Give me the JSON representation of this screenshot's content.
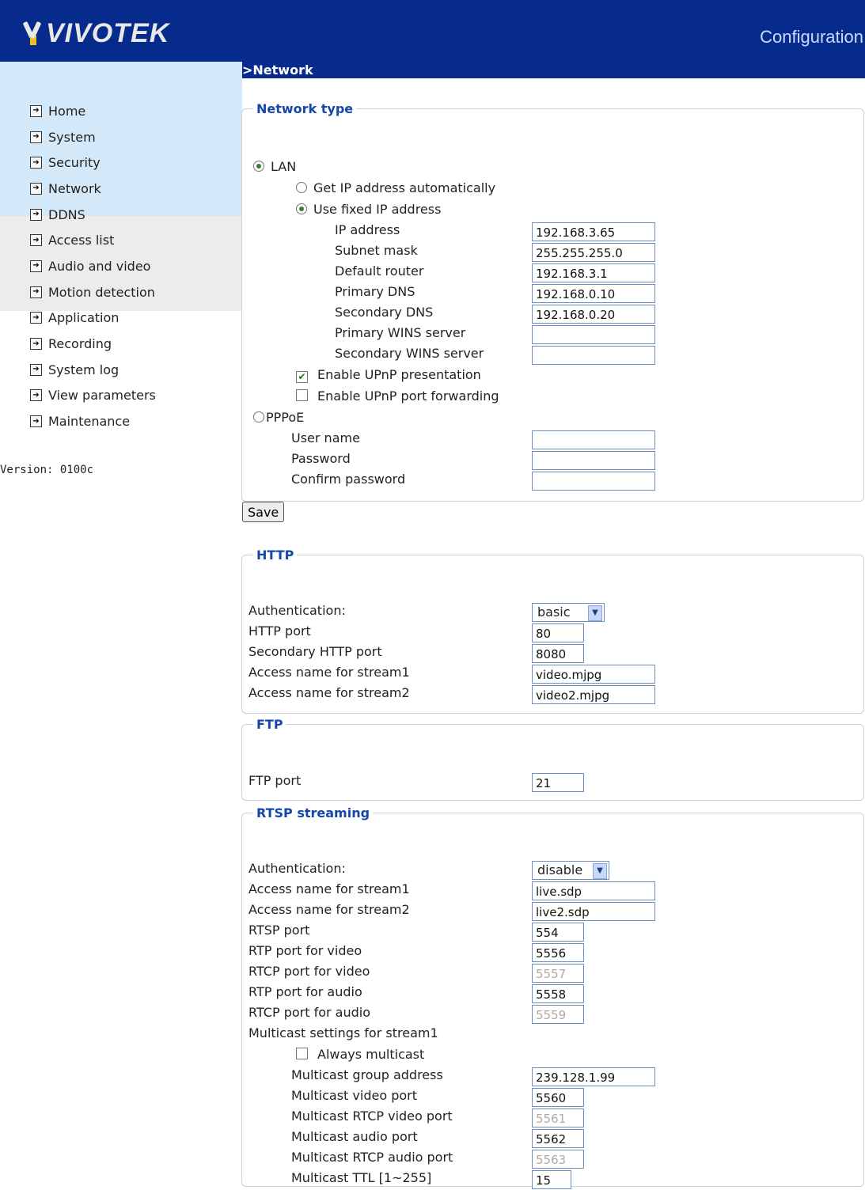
{
  "header": {
    "brand": "VIVOTEK",
    "title": "Configuration"
  },
  "sidebar": {
    "items": [
      {
        "label": "Home"
      },
      {
        "label": "System"
      },
      {
        "label": "Security"
      },
      {
        "label": "Network"
      },
      {
        "label": "DDNS"
      },
      {
        "label": "Access list"
      },
      {
        "label": "Audio and video"
      },
      {
        "label": "Motion detection"
      },
      {
        "label": "Application"
      },
      {
        "label": "Recording"
      },
      {
        "label": "System log"
      },
      {
        "label": "View parameters"
      },
      {
        "label": "Maintenance"
      }
    ],
    "version": "Version: 0100c"
  },
  "section_title": ">Network",
  "network_type": {
    "legend": "Network type",
    "lan_label": "LAN",
    "auto_label": "Get IP address automatically",
    "fixed_label": "Use fixed IP address",
    "fields": {
      "ip_label": "IP address",
      "ip_value": "192.168.3.65",
      "mask_label": "Subnet mask",
      "mask_value": "255.255.255.0",
      "router_label": "Default router",
      "router_value": "192.168.3.1",
      "dns1_label": "Primary DNS",
      "dns1_value": "192.168.0.10",
      "dns2_label": "Secondary DNS",
      "dns2_value": "192.168.0.20",
      "wins1_label": "Primary WINS server",
      "wins1_value": "",
      "wins2_label": "Secondary WINS server",
      "wins2_value": ""
    },
    "upnp_presentation": "Enable UPnP presentation",
    "upnp_forwarding": "Enable UPnP port forwarding",
    "pppoe_label": "PPPoE",
    "pppoe": {
      "user_label": "User name",
      "pass_label": "Password",
      "confirm_label": "Confirm password"
    }
  },
  "save_label": "Save",
  "http": {
    "legend": "HTTP",
    "auth_label": "Authentication:",
    "auth_value": "basic",
    "port_label": "HTTP port",
    "port_value": "80",
    "port2_label": "Secondary HTTP port",
    "port2_value": "8080",
    "s1_label": "Access name for stream1",
    "s1_value": "video.mjpg",
    "s2_label": "Access name for stream2",
    "s2_value": "video2.mjpg"
  },
  "ftp": {
    "legend": "FTP",
    "port_label": "FTP port",
    "port_value": "21"
  },
  "rtsp": {
    "legend": "RTSP streaming",
    "auth_label": "Authentication:",
    "auth_value": "disable",
    "s1_label": "Access name for stream1",
    "s1_value": "live.sdp",
    "s2_label": "Access name for stream2",
    "s2_value": "live2.sdp",
    "rtsp_port_label": "RTSP port",
    "rtsp_port_value": "554",
    "rtp_video_label": "RTP port for video",
    "rtp_video_value": "5556",
    "rtcp_video_label": "RTCP port for video",
    "rtcp_video_value": "5557",
    "rtp_audio_label": "RTP port for audio",
    "rtp_audio_value": "5558",
    "rtcp_audio_label": "RTCP port for audio",
    "rtcp_audio_value": "5559",
    "multicast_heading": "Multicast settings for stream1",
    "always_multicast": "Always multicast",
    "mc_group_label": "Multicast group address",
    "mc_group_value": "239.128.1.99",
    "mc_video_label": "Multicast video port",
    "mc_video_value": "5560",
    "mc_rtcp_video_label": "Multicast RTCP video port",
    "mc_rtcp_video_value": "5561",
    "mc_audio_label": "Multicast audio port",
    "mc_audio_value": "5562",
    "mc_rtcp_audio_label": "Multicast RTCP audio port",
    "mc_rtcp_audio_value": "5563",
    "mc_ttl_label": "Multicast TTL [1~255]",
    "mc_ttl_value": "15"
  }
}
